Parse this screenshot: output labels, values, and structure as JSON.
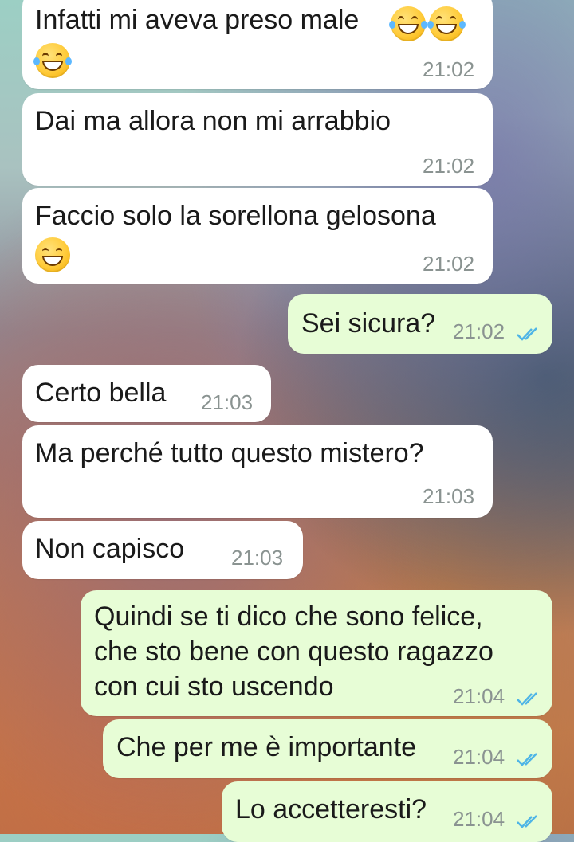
{
  "messages": [
    {
      "text": "Infatti mi aveva preso male",
      "time": "21:02",
      "emoji": [
        "rofl-emoji",
        "rofl-emoji",
        "rofl-emoji"
      ]
    },
    {
      "text": "Dai ma allora non mi arrabbio",
      "time": "21:02"
    },
    {
      "text": "Faccio solo la sorellona gelosona",
      "time": "21:02",
      "emoji": [
        "grin-emoji"
      ]
    },
    {
      "text": "Sei sicura?",
      "time": "21:02",
      "status_icon": "double-check-icon"
    },
    {
      "text": "Certo bella",
      "time": "21:03"
    },
    {
      "text": "Ma perché tutto questo mistero?",
      "time": "21:03"
    },
    {
      "text": "Non capisco",
      "time": "21:03"
    },
    {
      "lines": [
        "Quindi se ti dico che sono felice,",
        "che sto bene con questo ragazzo",
        "con cui sto uscendo"
      ],
      "time": "21:04",
      "status_icon": "double-check-icon"
    },
    {
      "text": "Che per me è importante",
      "time": "21:04",
      "status_icon": "double-check-icon"
    },
    {
      "text": "Lo accetteresti?",
      "time": "21:04",
      "status_icon": "double-check-icon"
    }
  ],
  "colors": {
    "incoming_bubble": "#ffffff",
    "outgoing_bubble": "#e7fdd6",
    "timestamp": "#8a9391",
    "read_check": "#4fb5e6"
  }
}
